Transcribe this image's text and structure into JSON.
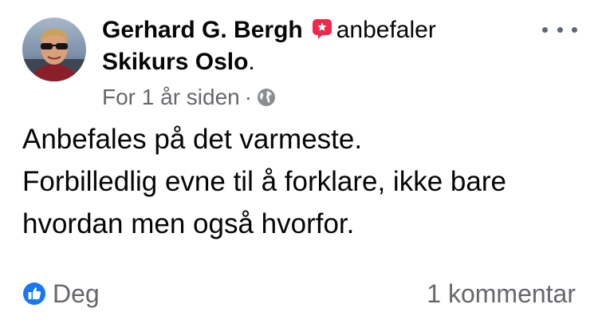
{
  "post": {
    "author": "Gerhard G. Bergh",
    "action": "anbefaler",
    "page": "Skikurs Oslo",
    "period": ".",
    "timestamp": "For 1 år siden",
    "separator": "·",
    "privacy_icon": "globe-icon",
    "recommend_icon": "recommend-flag-icon",
    "more_icon": "more-horizontal-icon",
    "body_lines": [
      "Anbefales på det varmeste.",
      "Forbilledlig evne til å forklare, ikke bare",
      "hvordan men også hvorfor."
    ]
  },
  "footer": {
    "reaction_icon": "like-icon",
    "reactions_label": "Deg",
    "comments_label": "1 kommentar"
  },
  "colors": {
    "text": "#050505",
    "secondary_text": "#65676b",
    "recommend_red": "#f02849",
    "like_blue": "#1877f2"
  }
}
